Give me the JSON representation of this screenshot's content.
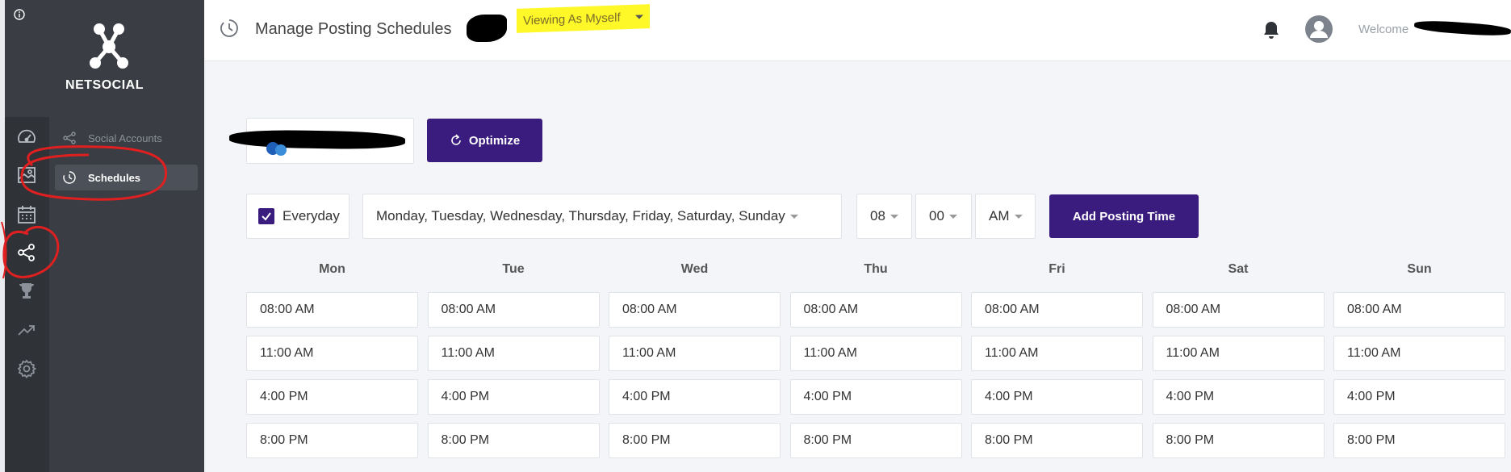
{
  "brand": {
    "name": "NETSOCIAL"
  },
  "rail": {
    "icons": [
      "dashboard-icon",
      "media-library-icon",
      "calendar-icon",
      "share-icon",
      "trophy-icon",
      "trending-icon",
      "settings-icon"
    ]
  },
  "submenu": {
    "items": [
      {
        "label": "Social Accounts",
        "icon": "share-icon",
        "active": false
      },
      {
        "label": "Schedules",
        "icon": "schedule-icon",
        "active": true
      }
    ]
  },
  "header": {
    "title": "Manage Posting Schedules",
    "viewing_as": "Viewing As Myself",
    "welcome": "Welcome"
  },
  "toolbar": {
    "optimize_label": "Optimize",
    "everyday_label": "Everyday",
    "everyday_checked": true,
    "days_value": "Monday, Tuesday, Wednesday, Thursday, Friday, Saturday, Sunday",
    "hour_value": "08",
    "minute_value": "00",
    "ampm_value": "AM",
    "add_label": "Add Posting Time"
  },
  "schedule": {
    "days": [
      "Mon",
      "Tue",
      "Wed",
      "Thu",
      "Fri",
      "Sat",
      "Sun"
    ],
    "times": [
      "08:00 AM",
      "11:00 AM",
      "4:00 PM",
      "8:00 PM"
    ]
  },
  "colors": {
    "primary": "#3a1b7e",
    "sidebar_dark": "#2f3237",
    "sidebar": "#3a3d43",
    "highlight": "#fff829",
    "annotation": "#e02020"
  }
}
